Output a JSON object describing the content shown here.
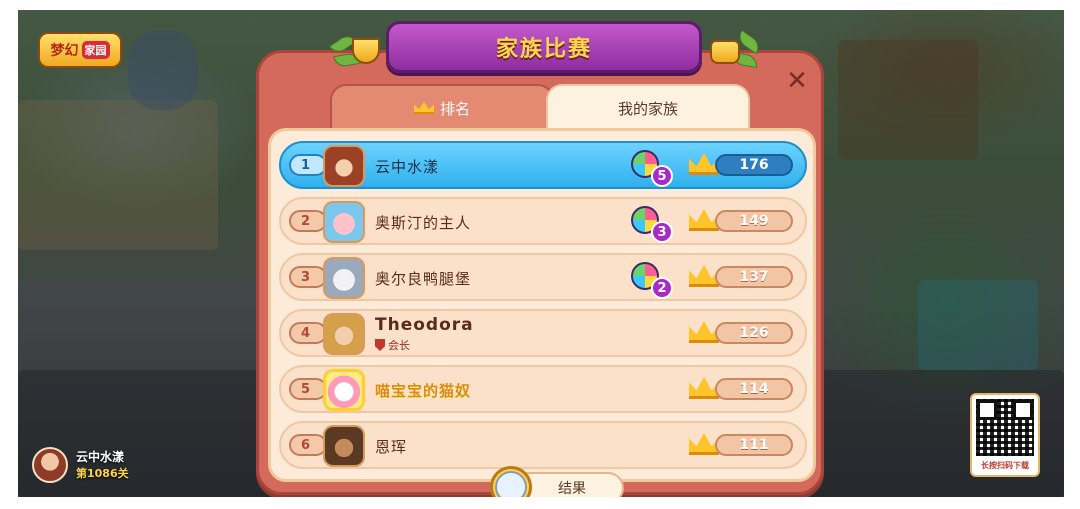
{
  "game": {
    "logo_main": "梦幻",
    "logo_sub": "家园"
  },
  "panel": {
    "title": "家族比赛",
    "tabs": [
      {
        "label": "排名",
        "active": false
      },
      {
        "label": "我的家族",
        "active": true
      }
    ],
    "result_button": "结果"
  },
  "rows": [
    {
      "rank": "1",
      "name": "云中水漾",
      "balls": "5",
      "score": "176",
      "highlight": true
    },
    {
      "rank": "2",
      "name": "奥斯汀的主人",
      "balls": "3",
      "score": "149"
    },
    {
      "rank": "3",
      "name": "奥尔良鸭腿堡",
      "balls": "2",
      "score": "137"
    },
    {
      "rank": "4",
      "name": "Theodora",
      "role": "会长",
      "score": "126"
    },
    {
      "rank": "5",
      "name": "喵宝宝的猫奴",
      "score": "114"
    },
    {
      "rank": "6",
      "name": "恩珲",
      "score": "111"
    }
  ],
  "player": {
    "name": "云中水漾",
    "level": "第1086关"
  },
  "qr": {
    "caption": "长按扫码下载"
  },
  "colors": {
    "highlight": "#2fb1ee",
    "panel": "#d46a5b",
    "banner": "#8f2da0",
    "crown": "#ffc42a"
  }
}
